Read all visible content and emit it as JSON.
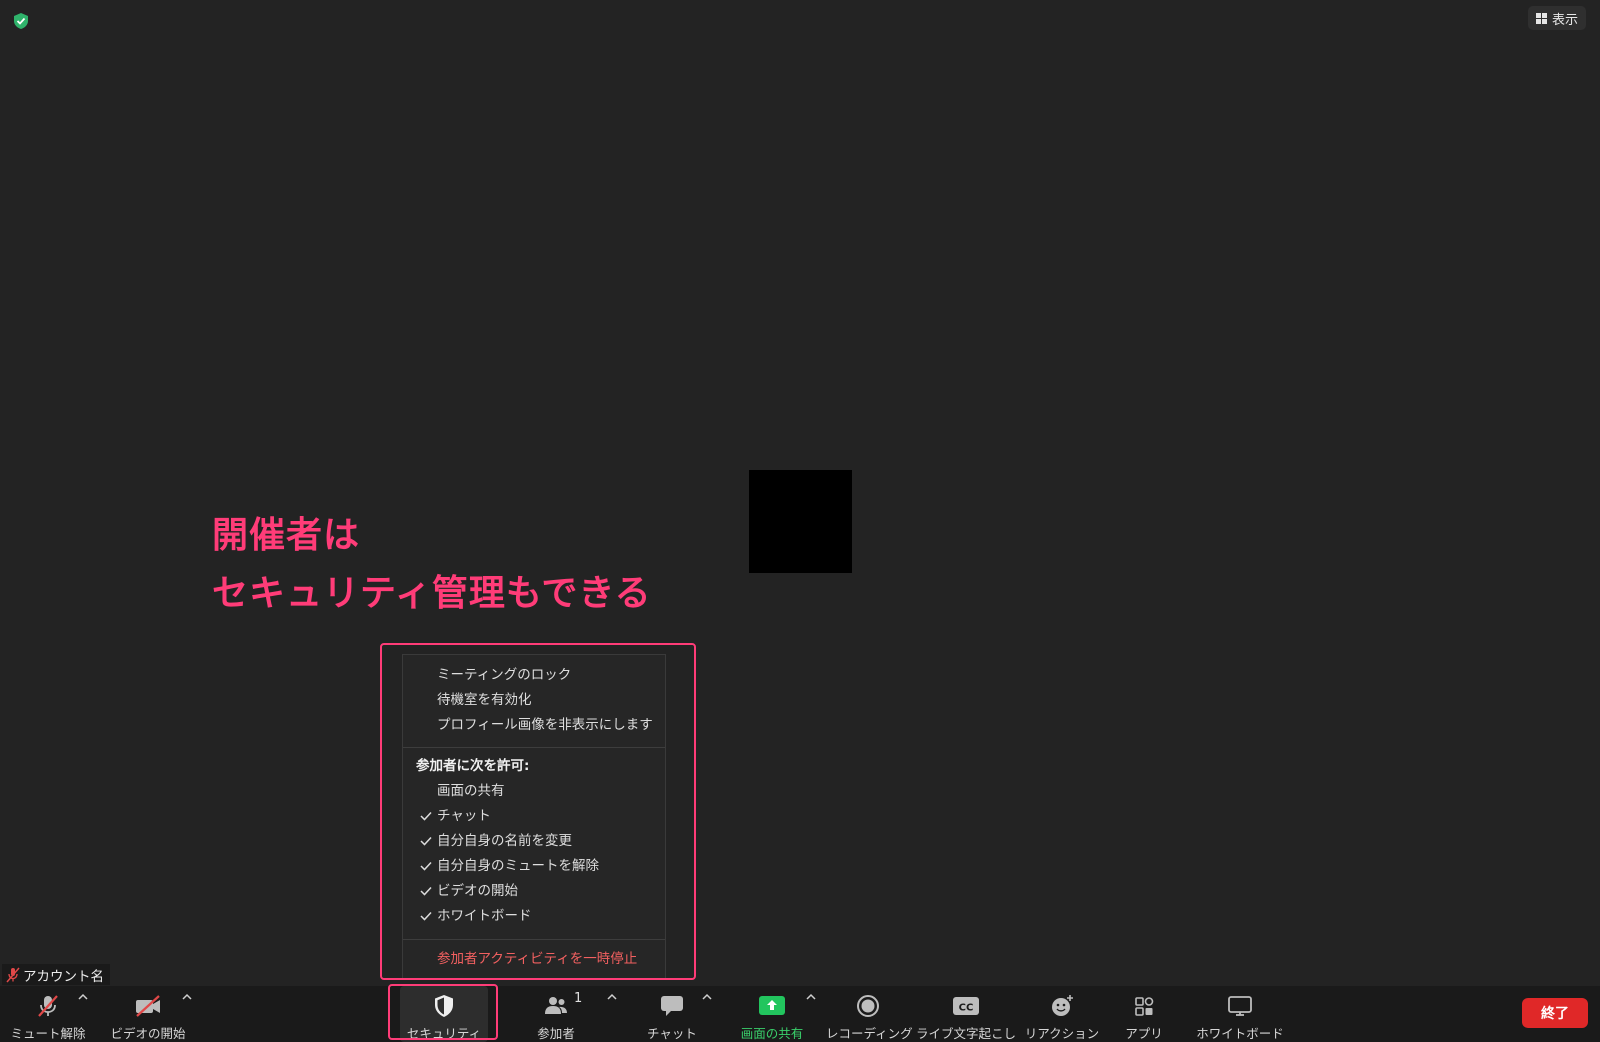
{
  "view_button": {
    "label": "表示"
  },
  "annotation": {
    "line1": "開催者は",
    "line2": "セキュリティ管理もできる"
  },
  "colors": {
    "accent_annotation": "#ff3c78",
    "share_green": "#22c55e",
    "end_red": "#e02828",
    "pause_red": "#f26060",
    "shield_green": "#2fb36b"
  },
  "security_menu": {
    "items": [
      {
        "label": "ミーティングのロック",
        "checked": false
      },
      {
        "label": "待機室を有効化",
        "checked": false
      },
      {
        "label": "プロフィール画像を非表示にします",
        "checked": false
      }
    ],
    "allow_header": "参加者に次を許可:",
    "allow_items": [
      {
        "label": "画面の共有",
        "checked": false
      },
      {
        "label": "チャット",
        "checked": true
      },
      {
        "label": "自分自身の名前を変更",
        "checked": true
      },
      {
        "label": "自分自身のミュートを解除",
        "checked": true
      },
      {
        "label": "ビデオの開始",
        "checked": true
      },
      {
        "label": "ホワイトボード",
        "checked": true
      }
    ],
    "pause_label": "参加者アクティビティを一時停止"
  },
  "account_tag": {
    "name": "アカウント名"
  },
  "toolbar": {
    "unmute": "ミュート解除",
    "start_video": "ビデオの開始",
    "security": "セキュリティ",
    "participants": "参加者",
    "participants_count": "1",
    "chat": "チャット",
    "share_screen": "画面の共有",
    "recording": "レコーディング",
    "live_transcript": "ライブ文字起こし",
    "reactions": "リアクション",
    "apps": "アプリ",
    "whiteboard": "ホワイトボード",
    "end": "終了"
  }
}
